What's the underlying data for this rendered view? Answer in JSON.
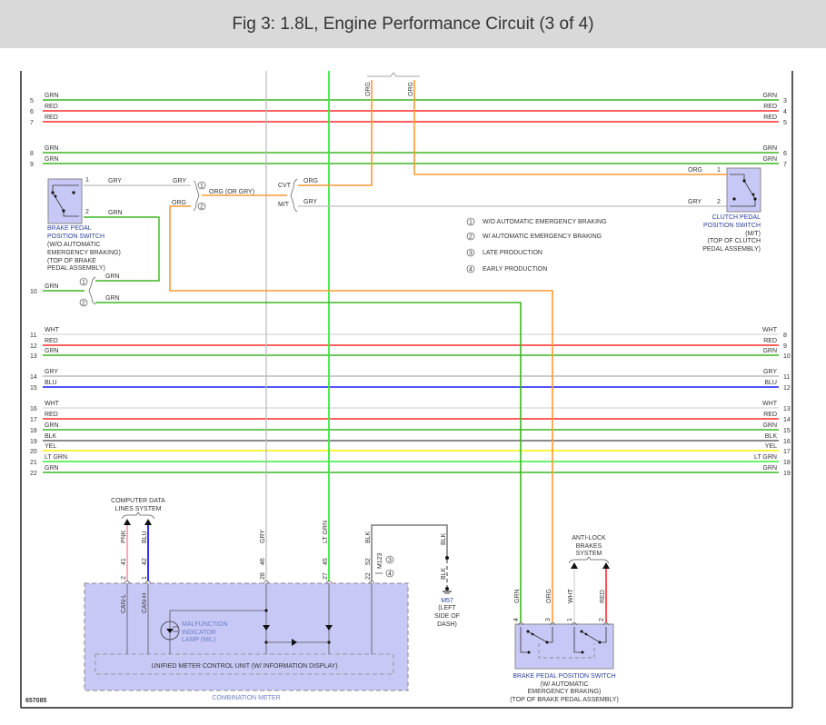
{
  "title": "Fig 3: 1.8L, Engine Performance Circuit (3 of 4)",
  "colors": {
    "GRN": "#3cb521",
    "LT GRN": "#38ee38",
    "RED": "#ff2a2a",
    "ORG": "#ff9a33",
    "GRY": "#bcbcbc",
    "WHT": "#dedede",
    "BLU": "#1a1aff",
    "BLK": "#7a7a7a",
    "YEL": "#f2f200",
    "PNK": "#ff8fa8",
    "component_fill": "#c8c8f7",
    "label_blue": "#6b80c6"
  },
  "bus_wires": [
    {
      "left_pin": "5",
      "right_pin": "3",
      "label": "GRN"
    },
    {
      "left_pin": "6",
      "right_pin": "4",
      "label": "RED"
    },
    {
      "left_pin": "7",
      "right_pin": "5",
      "label": "RED"
    },
    {
      "left_pin": "8",
      "right_pin": "6",
      "label": "GRN"
    },
    {
      "left_pin": "9",
      "right_pin": "7",
      "label": "GRN"
    },
    {
      "left_pin": "11",
      "right_pin": "8",
      "label": "WHT"
    },
    {
      "left_pin": "12",
      "right_pin": "9",
      "label": "RED"
    },
    {
      "left_pin": "13",
      "right_pin": "10",
      "label": "GRN"
    },
    {
      "left_pin": "14",
      "right_pin": "11",
      "label": "GRY"
    },
    {
      "left_pin": "15",
      "right_pin": "12",
      "label": "BLU"
    },
    {
      "left_pin": "16",
      "right_pin": "13",
      "label": "WHT"
    },
    {
      "left_pin": "17",
      "right_pin": "14",
      "label": "RED"
    },
    {
      "left_pin": "18",
      "right_pin": "15",
      "label": "GRN"
    },
    {
      "left_pin": "19",
      "right_pin": "16",
      "label": "BLK"
    },
    {
      "left_pin": "20",
      "right_pin": "17",
      "label": "YEL"
    },
    {
      "left_pin": "21",
      "right_pin": "18",
      "label": "LT GRN"
    },
    {
      "left_pin": "22",
      "right_pin": "19",
      "label": "GRN"
    }
  ],
  "top_org": {
    "left": "ORG",
    "right": "ORG"
  },
  "brake_switch_1": {
    "name_lines": [
      "BRAKE PEDAL",
      "POSITION SWITCH"
    ],
    "note_lines": [
      "(W/O AUTOMATIC",
      "EMERGENCY BRAKING)",
      "(TOP OF BRAKE",
      "PEDAL ASSEMBLY)"
    ],
    "pin1": "1",
    "pin2": "2",
    "pin1_wire": "GRY",
    "pin2_wire": "GRN"
  },
  "splice": {
    "gry_in": "GRY",
    "org_in": "ORG",
    "out": "ORG  (OR GRY)",
    "opt1": "1",
    "opt2": "2"
  },
  "trans": {
    "cvt": "CVT",
    "mt": "M/T",
    "cvt_wire": "ORG",
    "mt_wire": "GRY"
  },
  "row10": {
    "pin": "10",
    "in_wire": "GRN",
    "opt1_wire": "GRN",
    "opt2_wire": "GRN",
    "opt1": "1",
    "opt2": "2"
  },
  "clutch_switch": {
    "name_lines": [
      "CLUTCH PEDAL",
      "POSITION SWITCH"
    ],
    "note_lines": [
      "(M/T)",
      "(TOP OF CLUTCH",
      "PEDAL ASSEMBLY)"
    ],
    "pin1": "1",
    "pin2": "2",
    "pin1_wire": "ORG",
    "pin2_wire": "GRY"
  },
  "legend": [
    {
      "num": "1",
      "text": "W/O AUTOMATIC EMERGENCY BRAKING"
    },
    {
      "num": "2",
      "text": "W/ AUTOMATIC EMERGENCY BRAKING"
    },
    {
      "num": "3",
      "text": "LATE PRODUCTION"
    },
    {
      "num": "4",
      "text": "EARLY PRODUCTION"
    }
  ],
  "data_lines": {
    "label_lines": [
      "COMPUTER DATA",
      "LINES SYSTEM"
    ]
  },
  "meter": {
    "name": "COMBINATION METER",
    "unit": "UNIFIED METER CONTROL UNIT (W/ INFORMATION DISPLAY)",
    "mil_lines": [
      "MALFUNCTION",
      "INDICATOR",
      "LAMP (MIL)"
    ],
    "pins": [
      {
        "wire": "PNK",
        "conn": "41",
        "pin": "2",
        "signal": "CAN-L"
      },
      {
        "wire": "BLU",
        "conn": "42",
        "pin": "1",
        "signal": "CAN-H"
      },
      {
        "wire": "GRY",
        "conn": "46",
        "pin": "28"
      },
      {
        "wire": "LT GRN",
        "conn": "45",
        "pin": "27"
      },
      {
        "wire": "BLK",
        "conn": "52",
        "pin": "22",
        "conn_alt": "M123",
        "opt3": "3",
        "opt4": "4"
      }
    ]
  },
  "ground": {
    "wire_top": "BLK",
    "wire_bottom": "BLK",
    "lines": [
      "M57",
      "(LEFT",
      "SIDE OF",
      "DASH)"
    ]
  },
  "abs": {
    "label_lines": [
      "ANTI-LOCK",
      "BRAKES",
      "SYSTEM"
    ]
  },
  "brake_switch_2": {
    "name": "BRAKE PEDAL POSITION SWITCH",
    "note_lines": [
      "(W/ AUTOMATIC",
      "EMERGENCY BRAKING)",
      "(TOP OF BRAKE PEDAL ASSEMBLY)"
    ],
    "pins": [
      {
        "wire": "GRN",
        "pin": "4"
      },
      {
        "wire": "ORG",
        "pin": "3"
      },
      {
        "wire": "WHT",
        "pin": "1"
      },
      {
        "wire": "RED",
        "pin": "2"
      }
    ]
  },
  "figure_code": "657085"
}
